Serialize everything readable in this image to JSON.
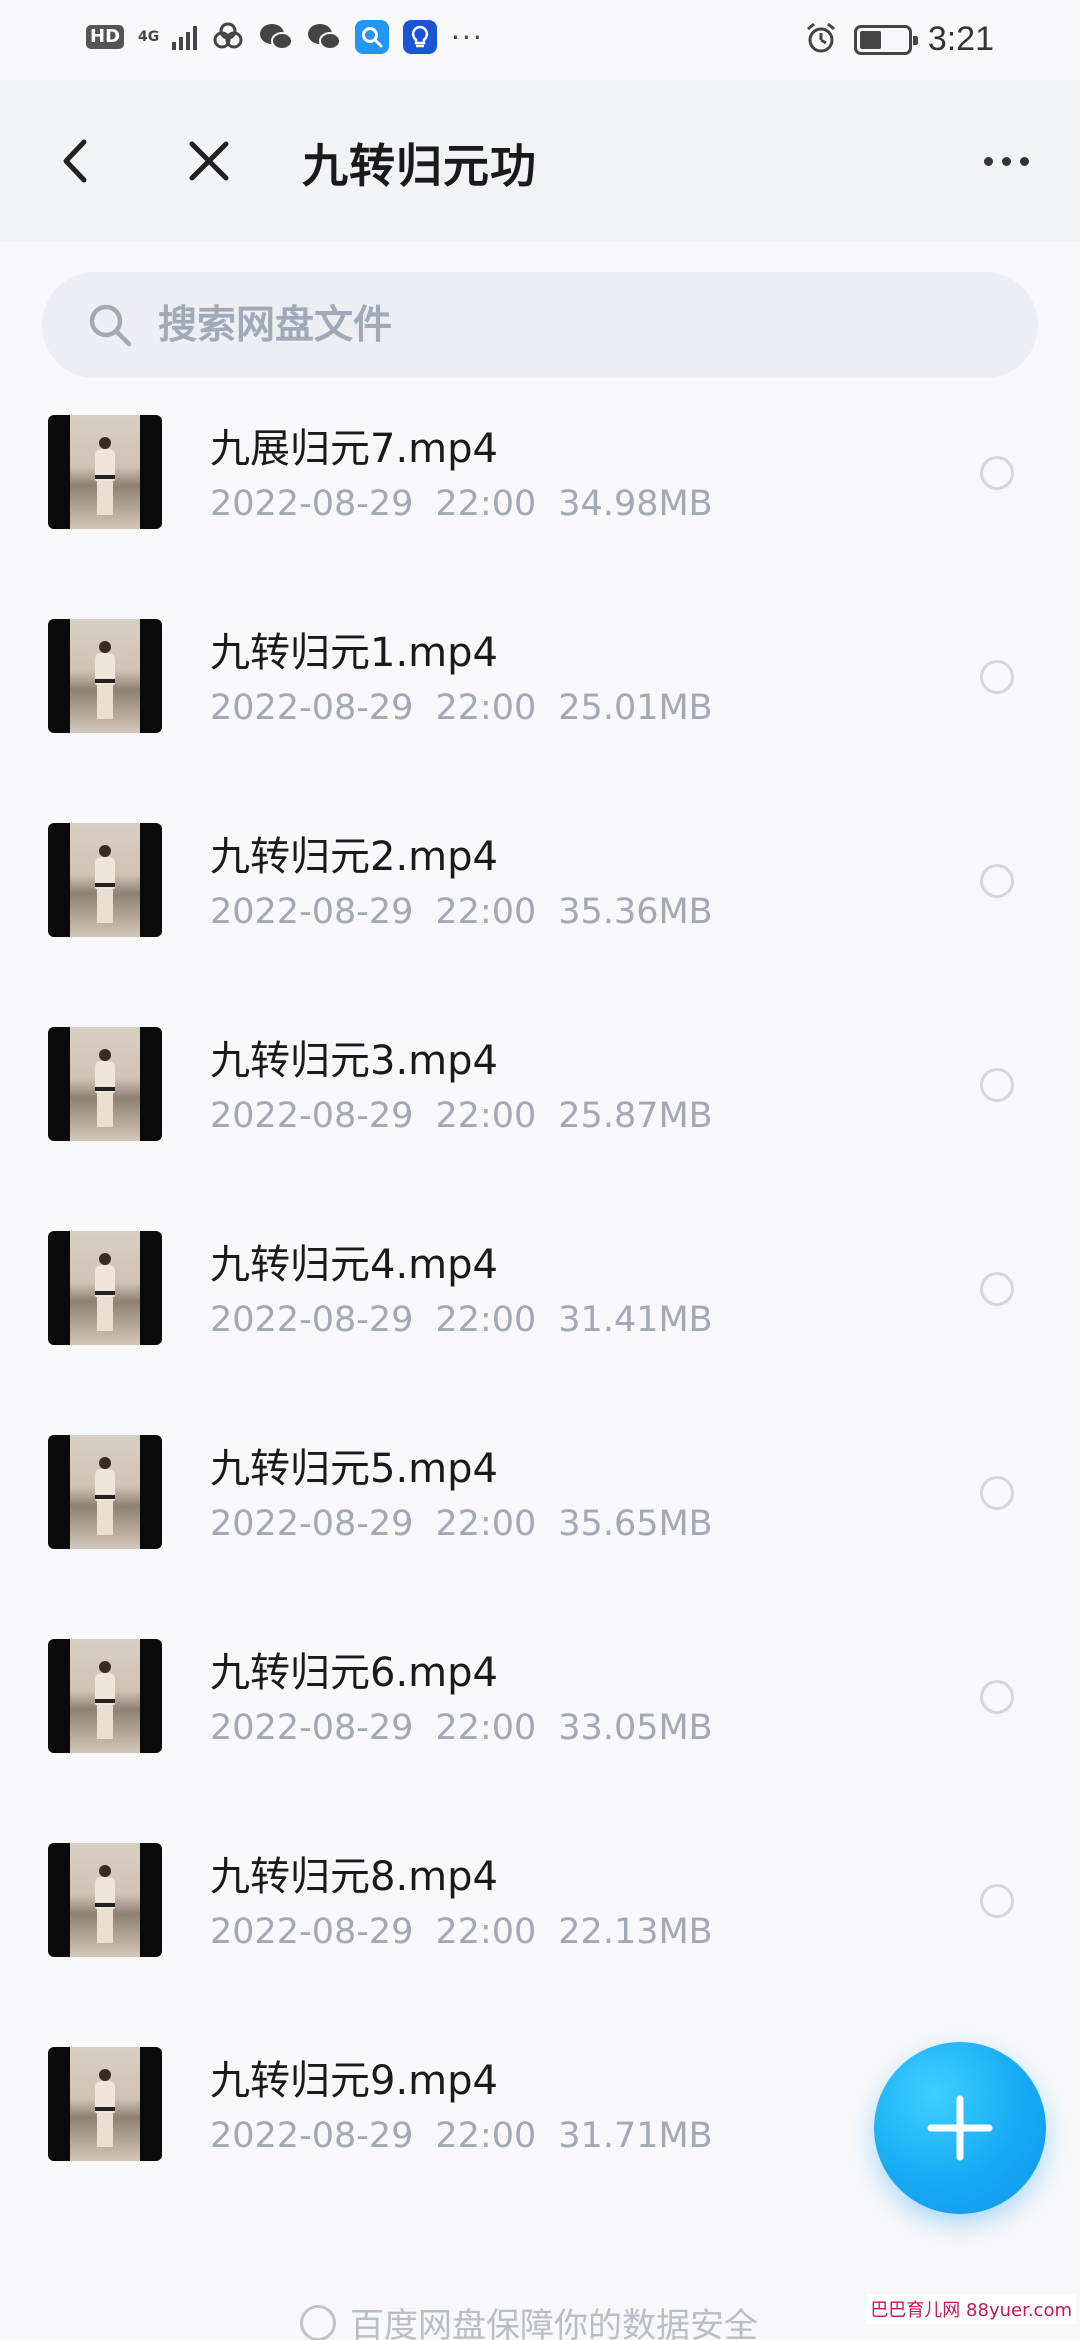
{
  "status_bar": {
    "hd": "HD",
    "network": "4G",
    "more": "···",
    "time": "3:21",
    "battery_level": 0.45
  },
  "nav": {
    "title": "九转归元功"
  },
  "search": {
    "placeholder": "搜索网盘文件"
  },
  "files": [
    {
      "name": "九展归元7.mp4",
      "date": "2022-08-29",
      "time": "22:00",
      "size": "34.98MB"
    },
    {
      "name": "九转归元1.mp4",
      "date": "2022-08-29",
      "time": "22:00",
      "size": "25.01MB"
    },
    {
      "name": "九转归元2.mp4",
      "date": "2022-08-29",
      "time": "22:00",
      "size": "35.36MB"
    },
    {
      "name": "九转归元3.mp4",
      "date": "2022-08-29",
      "time": "22:00",
      "size": "25.87MB"
    },
    {
      "name": "九转归元4.mp4",
      "date": "2022-08-29",
      "time": "22:00",
      "size": "31.41MB"
    },
    {
      "name": "九转归元5.mp4",
      "date": "2022-08-29",
      "time": "22:00",
      "size": "35.65MB"
    },
    {
      "name": "九转归元6.mp4",
      "date": "2022-08-29",
      "time": "22:00",
      "size": "33.05MB"
    },
    {
      "name": "九转归元8.mp4",
      "date": "2022-08-29",
      "time": "22:00",
      "size": "22.13MB"
    },
    {
      "name": "九转归元9.mp4",
      "date": "2022-08-29",
      "time": "22:00",
      "size": "31.71MB"
    }
  ],
  "footer": {
    "text": "百度网盘保障你的数据安全"
  },
  "watermark": "巴巴育儿网 88yuer.com",
  "colors": {
    "accent": "#17a9f4",
    "meta_text": "#a3a8b3",
    "nav_bg": "#f2f3f6"
  },
  "icons": {
    "back": "chevron-left-icon",
    "close": "close-icon",
    "more": "more-dots-icon",
    "search": "search-icon",
    "add": "plus-icon"
  }
}
